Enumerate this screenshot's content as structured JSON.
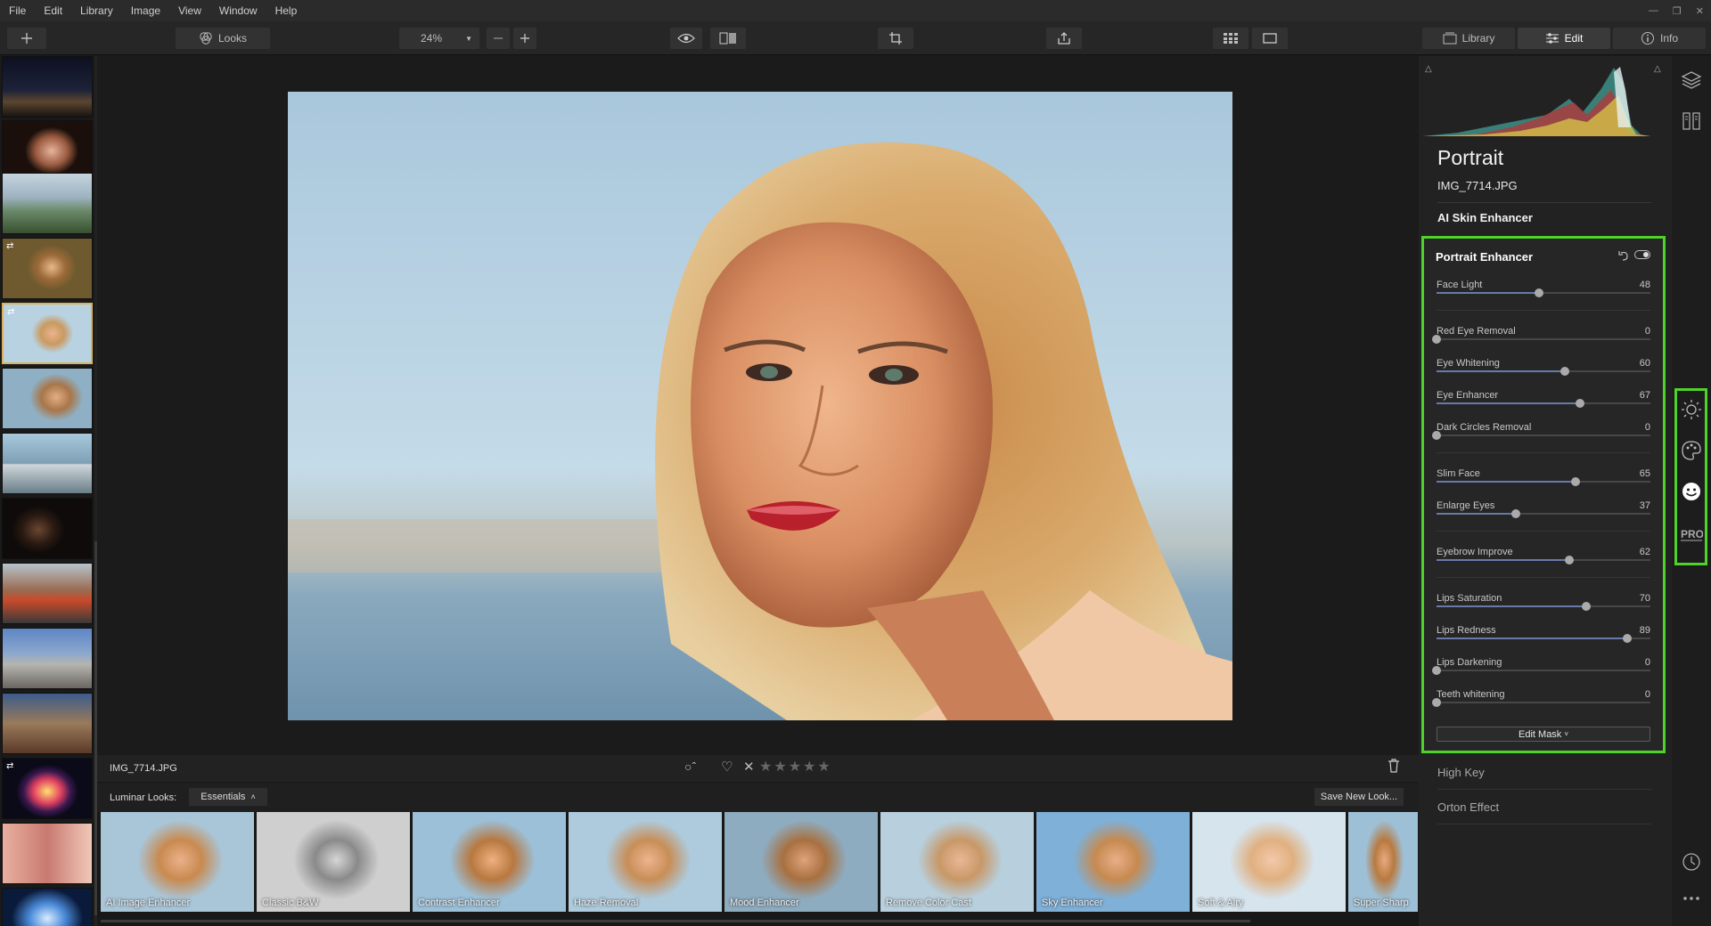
{
  "menu": [
    "File",
    "Edit",
    "Library",
    "Image",
    "View",
    "Window",
    "Help"
  ],
  "toolbar": {
    "looks_label": "Looks",
    "zoom_value": "24%",
    "library_tab": "Library",
    "edit_tab": "Edit",
    "info_tab": "Info"
  },
  "filmstrip": {
    "selected_index": 4
  },
  "infobar": {
    "filename": "IMG_7714.JPG"
  },
  "looksbar": {
    "label": "Luminar Looks:",
    "category": "Essentials",
    "save_label": "Save New Look..."
  },
  "looks": [
    "AI Image Enhancer",
    "Classic B&W",
    "Contrast Enhancer",
    "Haze Removal",
    "Mood Enhancer",
    "Remove Color Cast",
    "Sky Enhancer",
    "Soft & Airy",
    "Super Sharp"
  ],
  "panel": {
    "title": "Portrait",
    "filename": "IMG_7714.JPG",
    "tool_ai_skin": "AI Skin Enhancer",
    "enhancer_title": "Portrait Enhancer",
    "edit_mask": "Edit Mask",
    "tool_high_key": "High Key",
    "tool_orton": "Orton Effect"
  },
  "sliders": [
    {
      "name": "Face Light",
      "value": 48
    },
    {
      "name": "Red Eye Removal",
      "value": 0
    },
    {
      "name": "Eye Whitening",
      "value": 60
    },
    {
      "name": "Eye Enhancer",
      "value": 67
    },
    {
      "name": "Dark Circles Removal",
      "value": 0
    },
    {
      "name": "Slim Face",
      "value": 65
    },
    {
      "name": "Enlarge Eyes",
      "value": 37
    },
    {
      "name": "Eyebrow Improve",
      "value": 62
    },
    {
      "name": "Lips Saturation",
      "value": 70
    },
    {
      "name": "Lips Redness",
      "value": 89
    },
    {
      "name": "Lips Darkening",
      "value": 0
    },
    {
      "name": "Teeth whitening",
      "value": 0
    }
  ],
  "colors": {
    "highlight": "#4ed32a",
    "selected_thumb": "#d9b35c",
    "slider_fill": "#6a7aa8"
  }
}
